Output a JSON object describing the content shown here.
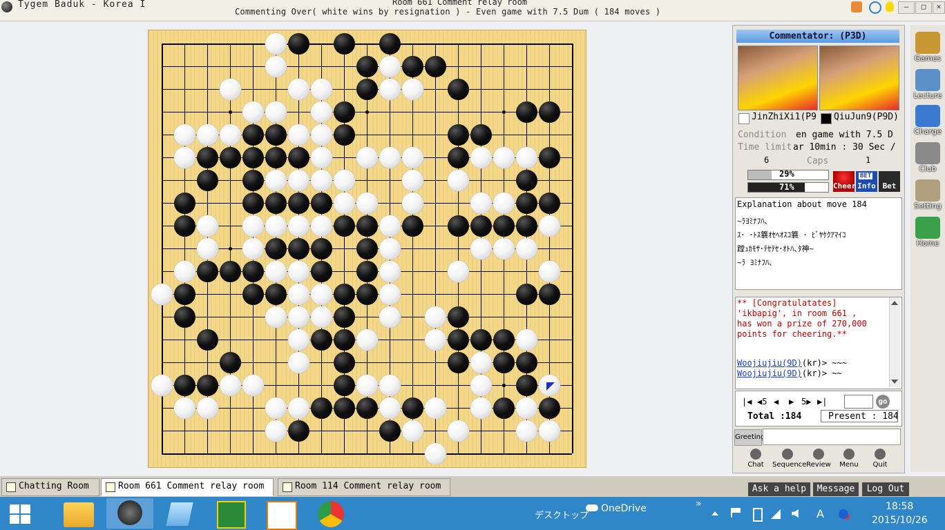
{
  "titlebar": {
    "app_title": "Tygem Baduk - Korea I",
    "room_title": "Room 661 Comment relay room",
    "game_status": "Commenting Over( white wins by resignation ) - Even game with 7.5 Dum  ( 184 moves )",
    "minimize": "—",
    "maximize": "□",
    "close": "✕"
  },
  "board": {
    "size": 19,
    "star_points": [
      [
        3,
        3
      ],
      [
        3,
        9
      ],
      [
        3,
        15
      ],
      [
        9,
        3
      ],
      [
        9,
        9
      ],
      [
        9,
        15
      ],
      [
        15,
        3
      ],
      [
        15,
        9
      ],
      [
        15,
        15
      ]
    ],
    "black_stones": [
      [
        0,
        6
      ],
      [
        0,
        8
      ],
      [
        0,
        10
      ],
      [
        1,
        9
      ],
      [
        1,
        11
      ],
      [
        1,
        12
      ],
      [
        2,
        9
      ],
      [
        2,
        13
      ],
      [
        3,
        8
      ],
      [
        3,
        16
      ],
      [
        3,
        17
      ],
      [
        4,
        4
      ],
      [
        4,
        5
      ],
      [
        4,
        8
      ],
      [
        4,
        13
      ],
      [
        4,
        14
      ],
      [
        5,
        2
      ],
      [
        5,
        3
      ],
      [
        5,
        4
      ],
      [
        5,
        5
      ],
      [
        5,
        6
      ],
      [
        5,
        13
      ],
      [
        5,
        17
      ],
      [
        6,
        2
      ],
      [
        6,
        4
      ],
      [
        6,
        16
      ],
      [
        7,
        1
      ],
      [
        7,
        4
      ],
      [
        7,
        5
      ],
      [
        7,
        6
      ],
      [
        7,
        7
      ],
      [
        7,
        16
      ],
      [
        7,
        17
      ],
      [
        8,
        1
      ],
      [
        8,
        8
      ],
      [
        8,
        9
      ],
      [
        8,
        11
      ],
      [
        8,
        13
      ],
      [
        8,
        14
      ],
      [
        8,
        15
      ],
      [
        8,
        16
      ],
      [
        9,
        5
      ],
      [
        9,
        6
      ],
      [
        9,
        7
      ],
      [
        9,
        9
      ],
      [
        10,
        2
      ],
      [
        10,
        3
      ],
      [
        10,
        4
      ],
      [
        10,
        7
      ],
      [
        10,
        9
      ],
      [
        11,
        1
      ],
      [
        11,
        4
      ],
      [
        11,
        5
      ],
      [
        11,
        8
      ],
      [
        11,
        9
      ],
      [
        11,
        16
      ],
      [
        11,
        17
      ],
      [
        12,
        1
      ],
      [
        12,
        8
      ],
      [
        12,
        13
      ],
      [
        13,
        2
      ],
      [
        13,
        7
      ],
      [
        13,
        8
      ],
      [
        13,
        13
      ],
      [
        13,
        14
      ],
      [
        13,
        15
      ],
      [
        14,
        3
      ],
      [
        14,
        8
      ],
      [
        14,
        13
      ],
      [
        14,
        15
      ],
      [
        14,
        16
      ],
      [
        15,
        1
      ],
      [
        15,
        2
      ],
      [
        15,
        8
      ],
      [
        15,
        16
      ],
      [
        16,
        7
      ],
      [
        16,
        8
      ],
      [
        16,
        9
      ],
      [
        16,
        11
      ],
      [
        16,
        15
      ],
      [
        16,
        17
      ],
      [
        17,
        6
      ],
      [
        17,
        10
      ]
    ],
    "white_stones": [
      [
        0,
        5
      ],
      [
        1,
        5
      ],
      [
        1,
        10
      ],
      [
        2,
        3
      ],
      [
        2,
        6
      ],
      [
        2,
        7
      ],
      [
        2,
        10
      ],
      [
        2,
        11
      ],
      [
        3,
        4
      ],
      [
        3,
        5
      ],
      [
        3,
        7
      ],
      [
        4,
        1
      ],
      [
        4,
        2
      ],
      [
        4,
        3
      ],
      [
        4,
        6
      ],
      [
        4,
        7
      ],
      [
        5,
        1
      ],
      [
        5,
        7
      ],
      [
        5,
        9
      ],
      [
        5,
        10
      ],
      [
        5,
        11
      ],
      [
        5,
        14
      ],
      [
        5,
        15
      ],
      [
        5,
        16
      ],
      [
        6,
        5
      ],
      [
        6,
        6
      ],
      [
        6,
        7
      ],
      [
        6,
        8
      ],
      [
        6,
        11
      ],
      [
        6,
        13
      ],
      [
        7,
        8
      ],
      [
        7,
        9
      ],
      [
        7,
        11
      ],
      [
        7,
        14
      ],
      [
        7,
        15
      ],
      [
        8,
        2
      ],
      [
        8,
        4
      ],
      [
        8,
        5
      ],
      [
        8,
        6
      ],
      [
        8,
        7
      ],
      [
        8,
        10
      ],
      [
        8,
        17
      ],
      [
        9,
        2
      ],
      [
        9,
        4
      ],
      [
        9,
        10
      ],
      [
        9,
        14
      ],
      [
        9,
        15
      ],
      [
        9,
        16
      ],
      [
        10,
        1
      ],
      [
        10,
        5
      ],
      [
        10,
        6
      ],
      [
        10,
        10
      ],
      [
        10,
        13
      ],
      [
        10,
        17
      ],
      [
        11,
        0
      ],
      [
        11,
        6
      ],
      [
        11,
        7
      ],
      [
        11,
        10
      ],
      [
        12,
        5
      ],
      [
        12,
        6
      ],
      [
        12,
        7
      ],
      [
        12,
        10
      ],
      [
        12,
        12
      ],
      [
        13,
        6
      ],
      [
        13,
        9
      ],
      [
        13,
        12
      ],
      [
        13,
        16
      ],
      [
        14,
        6
      ],
      [
        14,
        14
      ],
      [
        15,
        0
      ],
      [
        15,
        3
      ],
      [
        15,
        4
      ],
      [
        15,
        9
      ],
      [
        15,
        10
      ],
      [
        15,
        14
      ],
      [
        15,
        17
      ],
      [
        16,
        1
      ],
      [
        16,
        2
      ],
      [
        16,
        5
      ],
      [
        16,
        6
      ],
      [
        16,
        10
      ],
      [
        16,
        12
      ],
      [
        16,
        14
      ],
      [
        16,
        16
      ],
      [
        17,
        5
      ],
      [
        17,
        11
      ],
      [
        17,
        13
      ],
      [
        17,
        16
      ],
      [
        17,
        17
      ],
      [
        18,
        12
      ]
    ],
    "last_move": [
      15,
      17
    ]
  },
  "panel": {
    "commentator": "Commentator: (P3D)",
    "white_player": "JinZhiXi1(P9",
    "black_player": "QiuJun9(P9D)",
    "condition_label": "Condition",
    "condition_value": "en game with 7.5 D",
    "time_label": "Time limit",
    "time_value": "ar 10min : 30 Sec /",
    "caps_label": "Caps",
    "white_caps": "6",
    "black_caps": "1",
    "white_cheer_text": "29%",
    "black_cheer_text": "71%",
    "white_cheer_fraction": 0.29,
    "black_cheer_fraction": 0.71,
    "cheer_button": "Cheer",
    "info_button": "Info",
    "bet_button": "Bet",
    "info_badge": "BET"
  },
  "explanation": {
    "title": "Explanation about move 184",
    "lines": [
      "~ﾗﾖﾐﾅﾌﾊ､",
      "ｽ･ ･ﾄｽ簔ｵｾﾍｵｽｺ簔 ･ ﾋﾞﾔｹｸｱﾏｲｺ",
      "蹚ｭｶﾓｻ･ﾃｾﾃｾ･ｵﾄﾊ､ﾀ神~",
      "~ﾗ ﾖﾐﾅﾌﾊ､"
    ]
  },
  "chat": {
    "line1": "** [Congratulatates]",
    "line2": "'ikbapig', in room 661 ,",
    "line3": "has won a prize of 270,000",
    "line4": "points for cheering.**",
    "msg1_user": "Woojiujiu(9D)",
    "msg1_text": "(kr)> ~~~",
    "msg2_user": "Woojiujiu(9D)",
    "msg2_text": "(kr)> ~~"
  },
  "nav": {
    "first": "|◀",
    "back5": "◀5",
    "back": "◀",
    "forward": "▶",
    "forward5": "5▶",
    "last": "▶|",
    "go": "go",
    "total": "Total :184",
    "present": "Present : 184"
  },
  "greeting": {
    "label": "Greeting",
    "input": ""
  },
  "bottom_buttons": [
    "Chat",
    "Sequence",
    "Review",
    "Menu",
    "Quit"
  ],
  "side_menu": [
    "Games",
    "Lecture",
    "Charge",
    "Club",
    "Setting",
    "Home"
  ],
  "tabs": [
    {
      "label": "Chatting Room"
    },
    {
      "label": "Room 661 Comment relay room"
    },
    {
      "label": "Room 114 Comment relay room"
    }
  ],
  "footer_buttons": [
    "Ask a help",
    "Message",
    "Log Out"
  ],
  "taskbar": {
    "desktop_label": "デスクトップ",
    "onedrive_label": "OneDrive",
    "time": "18:58",
    "date": "2015/10/26",
    "ime": "A",
    "chevron": "»"
  }
}
